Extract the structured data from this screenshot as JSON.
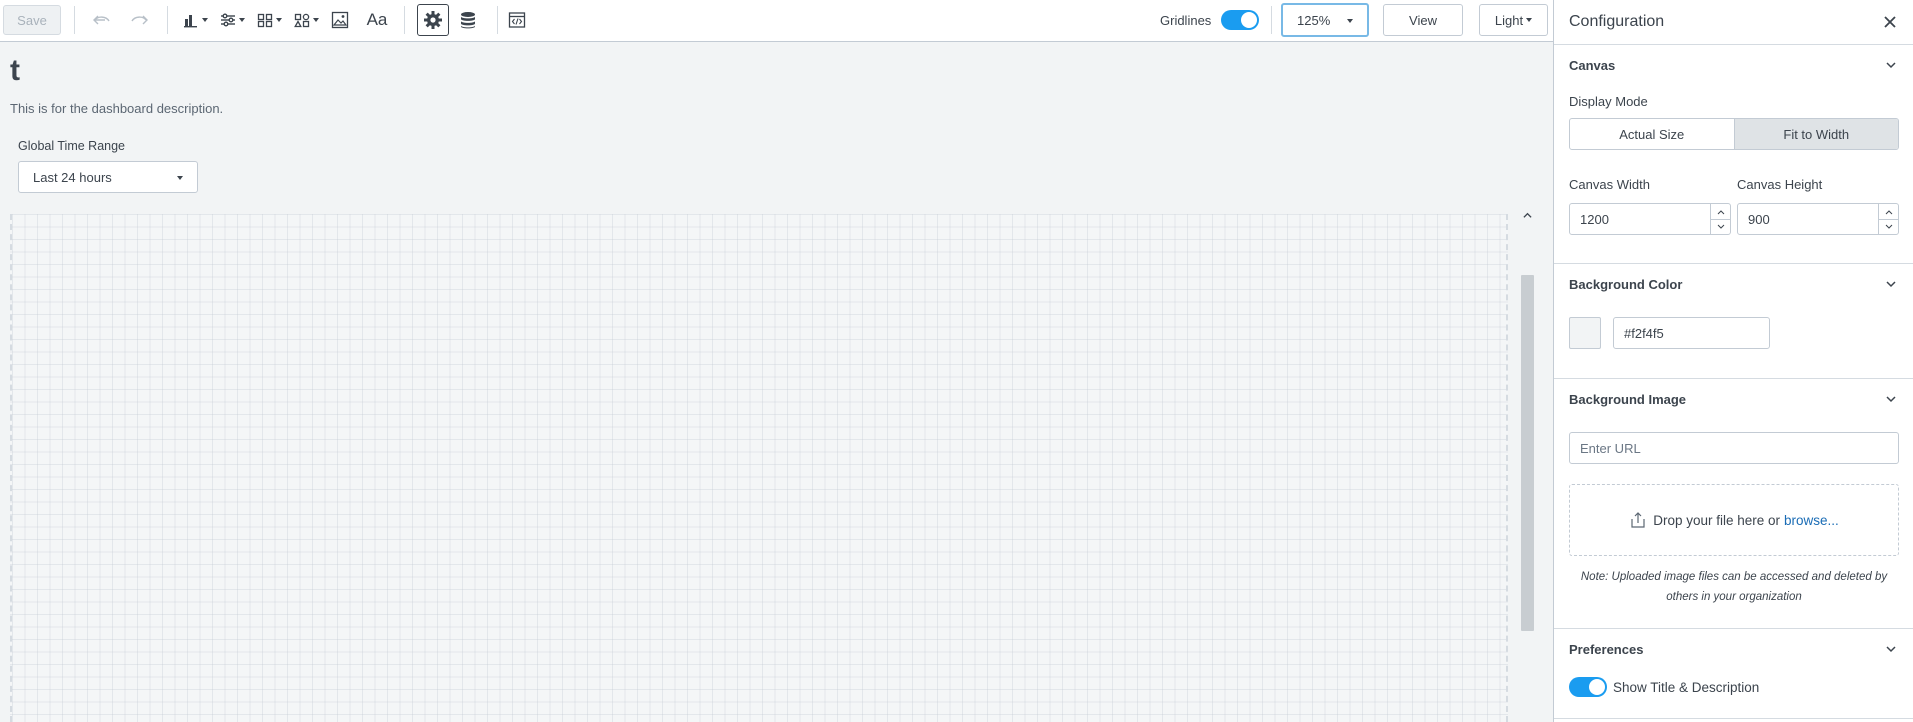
{
  "toolbar": {
    "save_label": "Save",
    "text_tool_label": "Aa",
    "gridlines_label": "Gridlines",
    "gridlines_on": true,
    "zoom_value": "125%",
    "view_label": "View",
    "theme_label": "Light"
  },
  "dashboard": {
    "title": "t",
    "description": "This is for the dashboard description.",
    "time_range_label": "Global Time Range",
    "time_range_value": "Last 24 hours"
  },
  "config": {
    "title": "Configuration",
    "canvas": {
      "heading": "Canvas",
      "display_mode_label": "Display Mode",
      "display_modes": [
        "Actual Size",
        "Fit to Width"
      ],
      "selected_mode": "Fit to Width",
      "width_label": "Canvas Width",
      "width_value": "1200",
      "height_label": "Canvas Height",
      "height_value": "900"
    },
    "background_color": {
      "heading": "Background Color",
      "value": "#f2f4f5",
      "swatch": "#f2f4f5"
    },
    "background_image": {
      "heading": "Background Image",
      "url_placeholder": "Enter URL",
      "drop_text": "Drop your file here or",
      "browse_link": "browse...",
      "note": "Note: Uploaded image files can be accessed and deleted by others in your organization"
    },
    "preferences": {
      "heading": "Preferences",
      "show_title_label": "Show Title & Description",
      "show_title_on": true
    }
  },
  "colors": {
    "accent": "#1a9cf0",
    "link": "#1a6cb5",
    "canvas_bg": "#f2f4f5",
    "text": "#3c444d"
  }
}
